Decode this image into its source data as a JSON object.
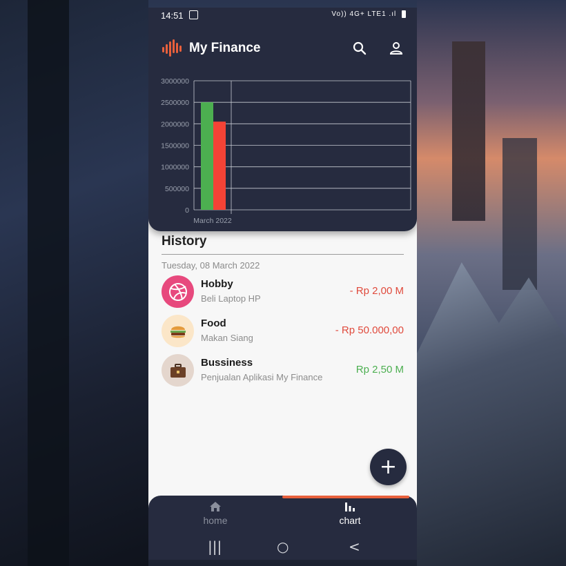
{
  "status_bar": {
    "time": "14:51",
    "icons": "Vo)) 4G+ LTE1 .ıl"
  },
  "app_bar": {
    "title": "My Finance",
    "search_icon": "search-icon",
    "account_icon": "account-icon"
  },
  "chart_data": {
    "type": "bar",
    "categories": [
      "March 2022"
    ],
    "series": [
      {
        "values": [
          2500000
        ],
        "color": "#4caf50"
      },
      {
        "values": [
          2050000
        ],
        "color": "#f44336"
      }
    ],
    "yticks": [
      0,
      500000,
      1000000,
      1500000,
      2000000,
      2500000,
      3000000
    ],
    "ylim": [
      0,
      3000000
    ],
    "grid": true
  },
  "history": {
    "title": "History",
    "date": "Tuesday, 08 March 2022",
    "items": [
      {
        "name": "Hobby",
        "desc": "Beli Laptop HP",
        "amount": "- Rp 2,00 M",
        "icon": "dribbble-icon",
        "amount_color": "#e04a3c"
      },
      {
        "name": "Food",
        "desc": "Makan Siang",
        "amount": "- Rp 50.000,00",
        "icon": "burger-icon",
        "amount_color": "#e04a3c"
      },
      {
        "name": "Bussiness",
        "desc": "Penjualan Aplikasi My Finance",
        "amount": "Rp 2,50 M",
        "icon": "briefcase-icon",
        "amount_color": "#4caf50"
      }
    ]
  },
  "fab": {
    "label": "+"
  },
  "bottom_nav": {
    "home_label": "home",
    "chart_label": "chart"
  },
  "system_nav": {
    "recents": "|||",
    "home": "○",
    "back": "<"
  }
}
